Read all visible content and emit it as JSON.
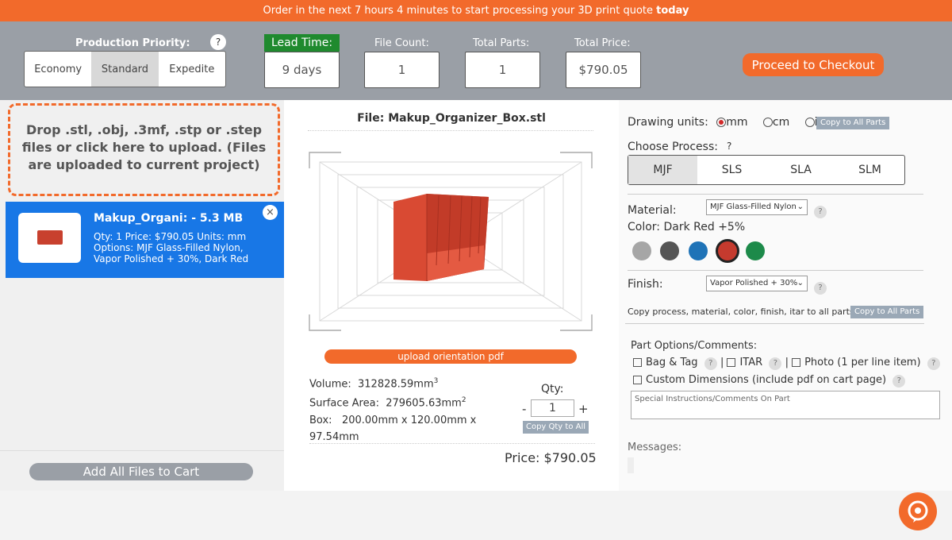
{
  "banner": {
    "text_prefix": "Order in the next 7 hours 4 minutes to start processing your 3D print quote ",
    "text_bold": "today"
  },
  "header": {
    "priority_label": "Production Priority:",
    "priority_help": "?",
    "priority_options": [
      "Economy",
      "Standard",
      "Expedite"
    ],
    "priority_selected": "Standard",
    "lead_time_label": "Lead Time:",
    "lead_time_value": "9 days",
    "file_count_label": "File Count:",
    "file_count_value": "1",
    "total_parts_label": "Total Parts:",
    "total_parts_value": "1",
    "total_price_label": "Total Price:",
    "total_price_value": "$790.05",
    "checkout_label": "Proceed to Checkout"
  },
  "left": {
    "dropzone_text": "Drop .stl, .obj, .3mf, .stp or .step files or click here to upload. (Files are uploaded to current project)",
    "file": {
      "name": "Makup_Organi:",
      "size": " - 5.3 MB",
      "qty_line": "Qty: 1   Price: $790.05   Units: mm",
      "options_line": "Options: MJF Glass-Filled Nylon, Vapor Polished + 30%, Dark Red"
    },
    "close_icon": "×",
    "add_all_label": "Add All Files to Cart"
  },
  "center": {
    "file_title": "File: Makup_Organizer_Box.stl",
    "upload_pdf_label": "upload orientation pdf",
    "volume_label": "Volume:",
    "volume_value": "312828.59mm",
    "volume_exp": "3",
    "area_label": "Surface Area:",
    "area_value": "279605.63mm",
    "area_exp": "2",
    "box_label": "Box:",
    "box_value": "200.00mm x 120.00mm x 97.54mm",
    "qty_label": "Qty:",
    "qty_minus": "-",
    "qty_value": "1",
    "qty_plus": "+",
    "copy_qty_label": "Copy Qty to All",
    "price_text": "Price: $790.05"
  },
  "right": {
    "units_label": "Drawing units:",
    "units": [
      "mm",
      "cm",
      "in"
    ],
    "units_selected": "mm",
    "copy_units_label": "Copy to All Parts",
    "process_label": "Choose Process:",
    "process_help": "?",
    "processes": [
      "MJF",
      "SLS",
      "SLA",
      "SLM"
    ],
    "process_selected": "MJF",
    "material_label": "Material:",
    "material_value": "MJF Glass-Filled Nylon",
    "color_label": "Color: Dark Red +5%",
    "colors": [
      "#a6a6a6",
      "#555555",
      "#1f73b7",
      "#c53a2e",
      "#1d8a4a"
    ],
    "color_selected_index": 3,
    "finish_label": "Finish:",
    "finish_value": "Vapor Polished + 30%",
    "copy_all_text": "Copy process, material, color, finish, itar to all parts:",
    "copy_all_label": "Copy to All Parts",
    "part_options_label": "Part Options/Comments:",
    "opt_bag": "Bag & Tag",
    "opt_itar": "ITAR",
    "opt_photo": "Photo (1 per line item)",
    "opt_custom": "Custom Dimensions (include pdf on cart page)",
    "comments_placeholder": "Special Instructions/Comments On Part",
    "messages_label": "Messages:",
    "help": "?"
  },
  "accent": "#f26a2b",
  "selection_blue": "#1877e6",
  "lead_green": "#1f8a2e"
}
